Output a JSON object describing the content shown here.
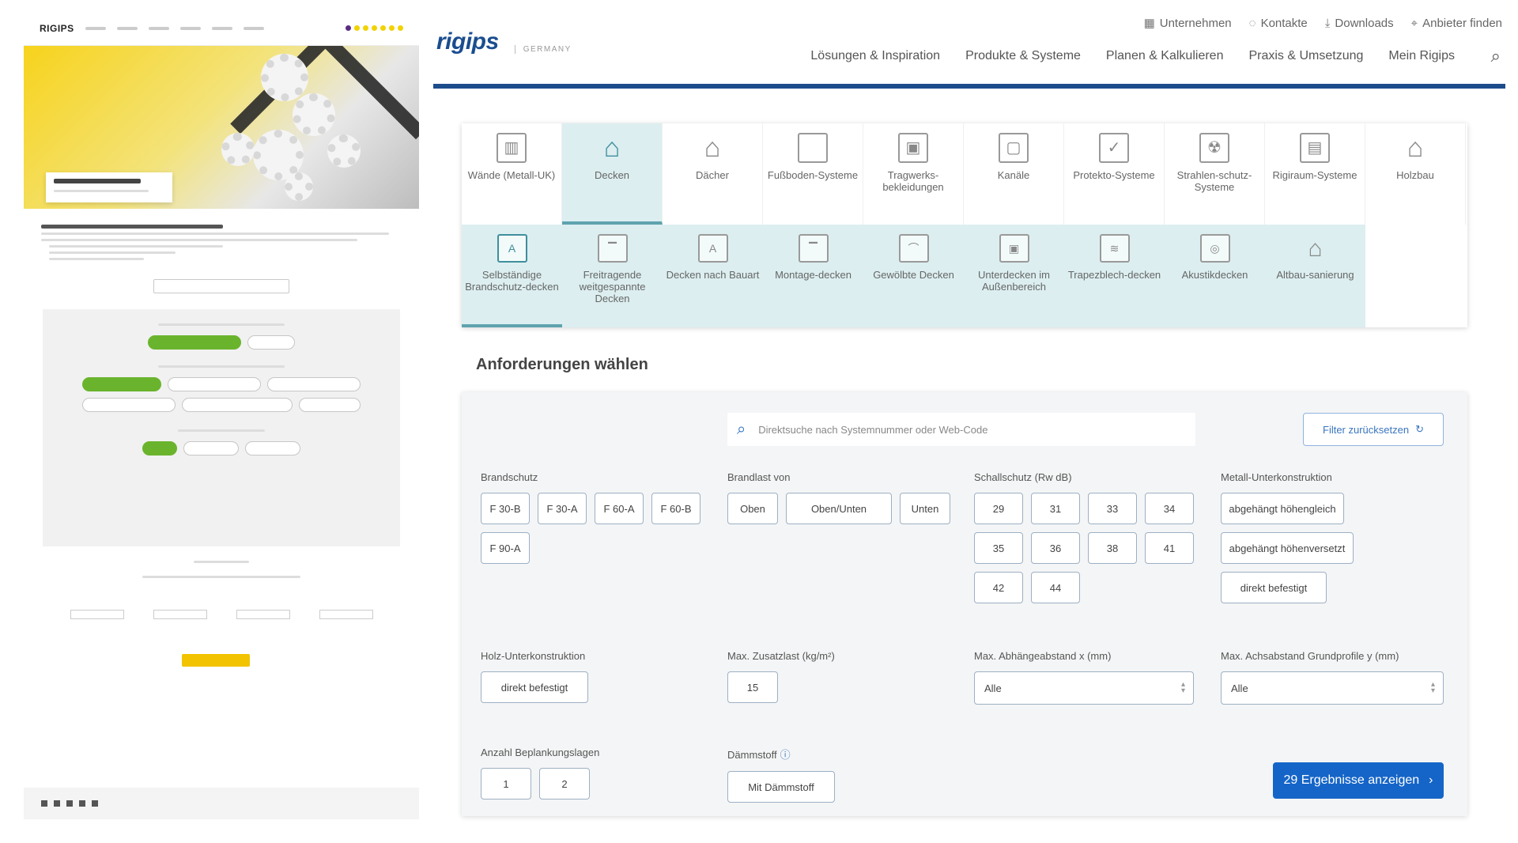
{
  "left_preview": {
    "logo": "RIGIPS"
  },
  "top_links": [
    {
      "label": "Unternehmen",
      "icon": "building-icon"
    },
    {
      "label": "Kontakte",
      "icon": "chat-icon"
    },
    {
      "label": "Downloads",
      "icon": "download-icon"
    },
    {
      "label": "Anbieter finden",
      "icon": "location-pin-icon"
    }
  ],
  "logo": {
    "brand": "rigips",
    "region": "GERMANY"
  },
  "main_nav": [
    "Lösungen & Inspiration",
    "Produkte & Systeme",
    "Planen & Kalkulieren",
    "Praxis & Umsetzung",
    "Mein Rigips"
  ],
  "categories": [
    {
      "label": "Wände (Metall-UK)",
      "icon": "wall-icon"
    },
    {
      "label": "Decken",
      "icon": "ceiling-icon",
      "active": true
    },
    {
      "label": "Dächer",
      "icon": "roof-icon"
    },
    {
      "label": "Fußboden-Systeme",
      "icon": "floor-icon"
    },
    {
      "label": "Tragwerks-bekleidungen",
      "icon": "beam-icon"
    },
    {
      "label": "Kanäle",
      "icon": "duct-icon"
    },
    {
      "label": "Protekto-Systeme",
      "icon": "shield-icon"
    },
    {
      "label": "Strahlen-schutz-Systeme",
      "icon": "radiation-icon"
    },
    {
      "label": "Rigiraum-Systeme",
      "icon": "room-icon"
    },
    {
      "label": "Holzbau",
      "icon": "house-icon"
    }
  ],
  "subcategories": [
    {
      "label": "Selbständige Brandschutz-decken",
      "icon": "fire-ceiling-icon",
      "active": true
    },
    {
      "label": "Freitragende weitgespannte Decken",
      "icon": "span-ceiling-icon"
    },
    {
      "label": "Decken nach Bauart",
      "icon": "type-ceiling-icon"
    },
    {
      "label": "Montage-decken",
      "icon": "mounting-ceiling-icon"
    },
    {
      "label": "Gewölbte Decken",
      "icon": "vaulted-ceiling-icon"
    },
    {
      "label": "Unterdecken im Außenbereich",
      "icon": "outdoor-ceiling-icon"
    },
    {
      "label": "Trapezblech-decken",
      "icon": "trapezoid-ceiling-icon"
    },
    {
      "label": "Akustikdecken",
      "icon": "acoustic-ceiling-icon"
    },
    {
      "label": "Altbau-sanierung",
      "icon": "renovation-icon"
    }
  ],
  "filters": {
    "title": "Anforderungen wählen",
    "search_placeholder": "Direktsuche nach Systemnummer oder Web-Code",
    "reset_label": "Filter zurücksetzen",
    "brandschutz": {
      "label": "Brandschutz",
      "options": [
        "F 30-B",
        "F 30-A",
        "F 60-A",
        "F 60-B",
        "F 90-A"
      ]
    },
    "brandlast": {
      "label": "Brandlast von",
      "options": [
        "Oben",
        "Oben/Unten",
        "Unten"
      ]
    },
    "schallschutz": {
      "label": "Schallschutz (Rw dB)",
      "options": [
        "29",
        "31",
        "33",
        "34",
        "35",
        "36",
        "38",
        "41",
        "42",
        "44"
      ]
    },
    "metall_uk": {
      "label": "Metall-Unterkonstruktion",
      "options": [
        "abgehängt höhengleich",
        "abgehängt höhenversetzt",
        "direkt befestigt"
      ]
    },
    "holz_uk": {
      "label": "Holz-Unterkonstruktion",
      "options": [
        "direkt befestigt"
      ]
    },
    "zusatzlast": {
      "label": "Max. Zusatzlast (kg/m²)",
      "options": [
        "15"
      ]
    },
    "abhaenger": {
      "label": "Max. Abhängeabstand x (mm)",
      "value": "Alle"
    },
    "achsabstand": {
      "label": "Max. Achsabstand Grundprofile y (mm)",
      "value": "Alle"
    },
    "beplankung": {
      "label": "Anzahl Beplankungslagen",
      "options": [
        "1",
        "2"
      ]
    },
    "daemmstoff": {
      "label": "Dämmstoff",
      "options": [
        "Mit Dämmstoff"
      ]
    },
    "cta_label": "29 Ergebnisse anzeigen"
  }
}
